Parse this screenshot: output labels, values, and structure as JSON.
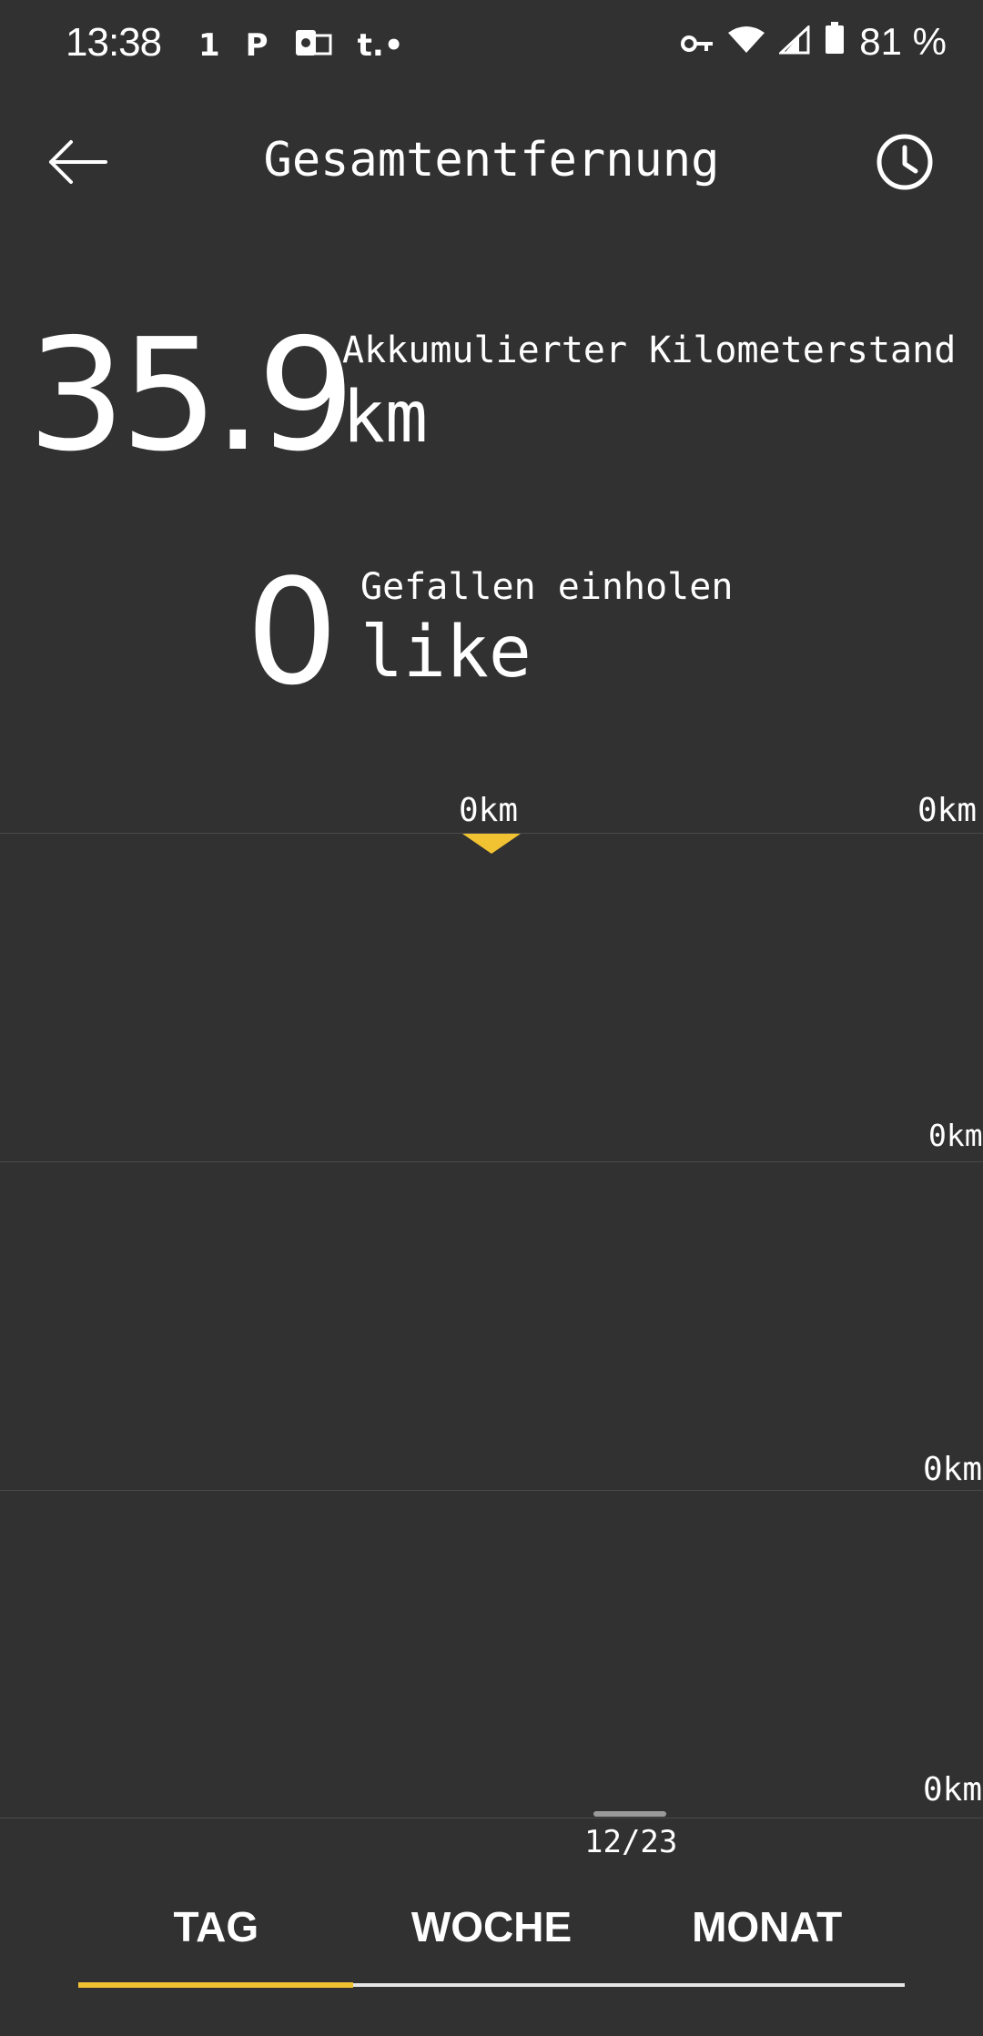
{
  "status_bar": {
    "time": "13:38",
    "battery": "81 %",
    "left_icons": [
      "fitness-1-icon",
      "paypal-icon",
      "outlook-icon",
      "telekom-icon"
    ],
    "right_icons": [
      "key-icon",
      "wifi-icon",
      "signal-icon",
      "battery-icon"
    ]
  },
  "app_bar": {
    "title": "Gesamtentfernung",
    "back_icon": "arrow-left-icon",
    "history_icon": "clock-icon"
  },
  "totals": {
    "distance_value": "35.9",
    "distance_label": "Akkumulierter Kilometerstand",
    "distance_unit": "km",
    "catch_value": "0",
    "catch_label": "Gefallen einholen",
    "catch_unit": "like"
  },
  "chart": {
    "marker_label": "0km",
    "top_right_label": "0km",
    "grid_labels": [
      "0km",
      "0km",
      "0km"
    ],
    "date_label": "12/23"
  },
  "tabs": {
    "items": [
      "TAG",
      "WOCHE",
      "MONAT"
    ],
    "active_index": 0
  },
  "colors": {
    "background": "#313131",
    "accent": "#f1c232",
    "text": "#ffffff"
  }
}
